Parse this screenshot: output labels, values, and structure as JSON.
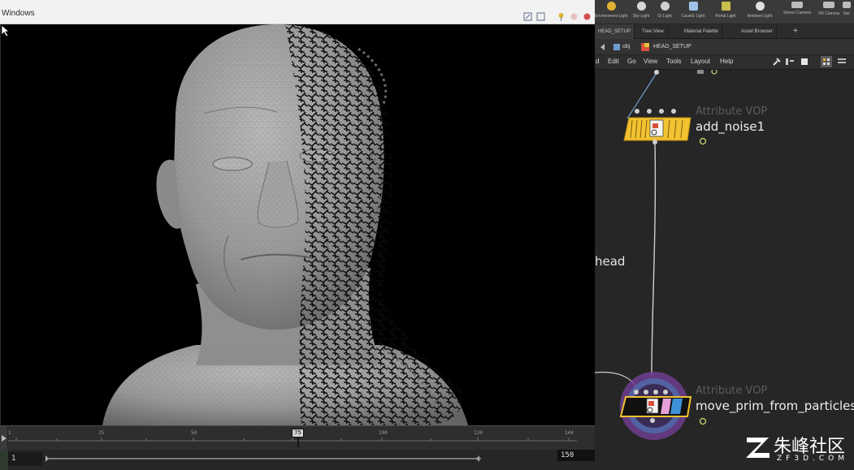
{
  "window": {
    "title": "Windows"
  },
  "timeline": {
    "ticks": [
      "1",
      "25",
      "50",
      "75",
      "100",
      "120",
      "144"
    ],
    "current_frame": "75",
    "range_start": "1",
    "range_end": "150"
  },
  "shelf": {
    "tools": [
      {
        "label": "Environment Light",
        "color": "#e2b233"
      },
      {
        "label": "Sky Light",
        "color": "#d8d8d8"
      },
      {
        "label": "GI Light",
        "color": "#d0d0d0"
      },
      {
        "label": "Caustic Light",
        "color": "#9ec3e8"
      },
      {
        "label": "Portal Light",
        "color": "#c8c04a"
      },
      {
        "label": "Ambient Light",
        "color": "#e0e0e0"
      },
      {
        "label": "Stereo Camera",
        "color": "#bdbdbd"
      },
      {
        "label": "VR Camera",
        "color": "#bdbdbd"
      },
      {
        "label": "Swi",
        "color": "#bdbdbd"
      }
    ]
  },
  "pane_tabs": [
    "HEAD_SETUP",
    "Tree View",
    "Material Palette",
    "Asset Browser"
  ],
  "path": {
    "context": "obj",
    "node": "HEAD_SETUP"
  },
  "menu": [
    "d",
    "Edit",
    "Go",
    "View",
    "Tools",
    "Layout",
    "Help"
  ],
  "network": {
    "nodes": [
      {
        "type": "Attribute VOP",
        "name": "add_noise1"
      },
      {
        "type": "Attribute VOP",
        "name": "move_prim_from_particles"
      }
    ],
    "side_label": "head"
  },
  "watermark": {
    "cn": "朱峰社区",
    "en": "ZF3D.COM"
  }
}
